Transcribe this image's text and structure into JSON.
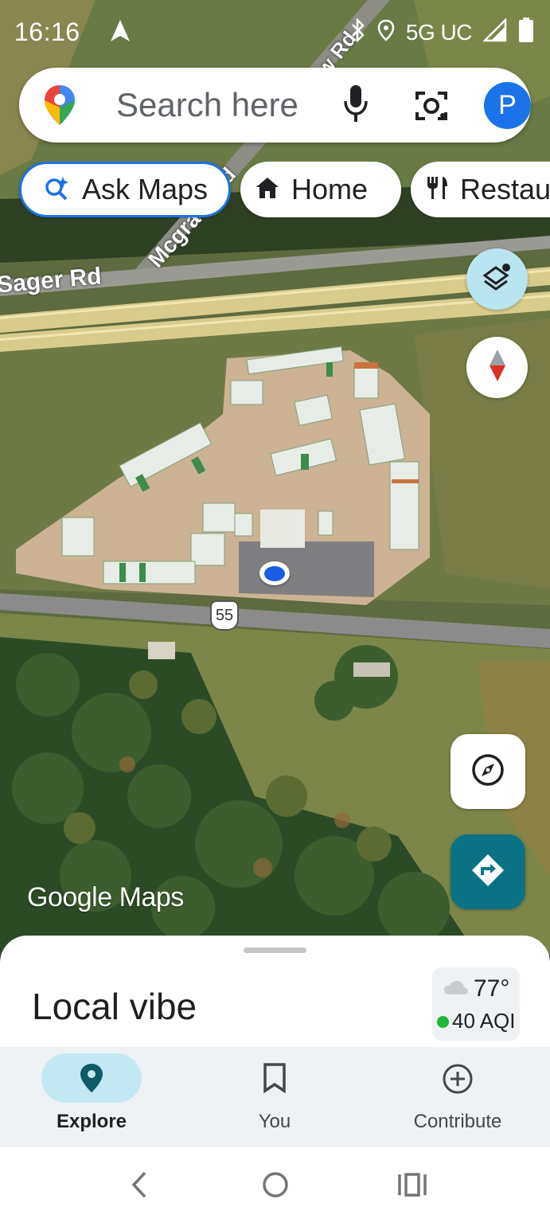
{
  "status_bar": {
    "time": "16:16",
    "network": "5G UC",
    "icons": [
      "navigation-arrow-icon",
      "bluetooth-icon",
      "location-icon",
      "signal-icon",
      "battery-icon"
    ]
  },
  "search": {
    "placeholder": "Search here",
    "avatar_initial": "P",
    "icons": [
      "maps-pin-logo",
      "mic-icon",
      "lens-camera-icon"
    ]
  },
  "chips": [
    {
      "label": "Ask Maps",
      "icon": "sparkle-search-icon"
    },
    {
      "label": "Home",
      "icon": "home-icon"
    },
    {
      "label": "Restau",
      "icon": "restaurant-icon"
    }
  ],
  "map": {
    "road_labels": [
      "Sager Rd",
      "Mcgra",
      "w Rd",
      "d"
    ],
    "route_shield": "55",
    "watermark": "Google Maps",
    "accent": "#1a73e8"
  },
  "controls": [
    "layers-icon",
    "compass-icon",
    "recenter-icon",
    "directions-icon"
  ],
  "sheet": {
    "title": "Local vibe",
    "weather": {
      "temp": "77°",
      "aqi": "40 AQI"
    }
  },
  "bottom_nav": [
    {
      "label": "Explore",
      "active": true
    },
    {
      "label": "You",
      "active": false
    },
    {
      "label": "Contribute",
      "active": false
    }
  ]
}
